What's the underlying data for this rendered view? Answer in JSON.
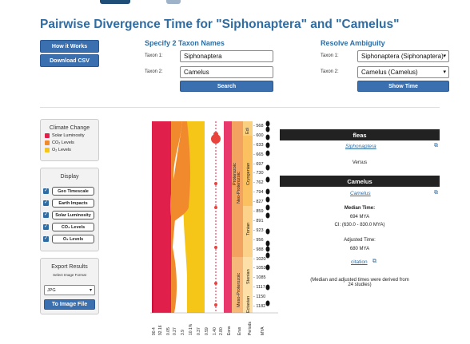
{
  "page": {
    "title": "Pairwise Divergence Time for \"Siphonaptera\" and \"Camelus\""
  },
  "actions": {
    "how_it_works": "How it Works",
    "download_csv": "Download CSV"
  },
  "specify": {
    "heading": "Specify 2 Taxon Names",
    "taxon1_label": "Taxon 1:",
    "taxon1_value": "Siphonaptera",
    "taxon2_label": "Taxon 2:",
    "taxon2_value": "Camelus",
    "search_label": "Search"
  },
  "resolve": {
    "heading": "Resolve Ambiguity",
    "taxon1_label": "Taxon 1:",
    "taxon1_value": "Siphonaptera (Siphonaptera)",
    "taxon2_label": "Taxon 2:",
    "taxon2_value": "Camelus (Camelus)",
    "show_time_label": "Show Time"
  },
  "climate": {
    "title": "Climate Change",
    "items": [
      {
        "label": "Solar Luminosity",
        "color": "#e0204a"
      },
      {
        "label": "CO₂ Levels",
        "color": "#f08a2c"
      },
      {
        "label": "O₂ Levels",
        "color": "#f5c518"
      }
    ]
  },
  "display": {
    "title": "Display",
    "items": [
      "Geo Timescale",
      "Earth Impacts",
      "Solar Luminosity",
      "CO₂ Levels",
      "O₂ Levels"
    ]
  },
  "export": {
    "title": "Export Results",
    "format_label": "Select Image Format",
    "format_value": "JPG",
    "button_label": "To Image File"
  },
  "timeline": {
    "bottom_labels": [
      "90.4",
      "92.16",
      "0.05",
      "0.27",
      "3.9",
      "10.1%",
      "0.37",
      "0.59",
      "1.40",
      "2.80",
      "Eons",
      "Eras",
      "Periods",
      "MYA"
    ],
    "eon_label": "Proterozoic",
    "era_labels": [
      "Neo-Proterozoic",
      "Meso-Proterozoic"
    ],
    "period_labels": [
      "Edi",
      "Cryogenian",
      "Tonian",
      "Stenian",
      "Ectasian"
    ],
    "mya_ticks": [
      "568",
      "600",
      "633",
      "665",
      "697",
      "730",
      "762",
      "794",
      "827",
      "859",
      "891",
      "923",
      "956",
      "988",
      "1020",
      "1053",
      "1085",
      "1117",
      "1150",
      "1182"
    ]
  },
  "results": {
    "taxon1_common": "fleas",
    "taxon1_link": "Siphonaptera",
    "versus": "Versus",
    "taxon2_common": "Camelus",
    "taxon2_link": "Camelus",
    "median_label": "Median Time:",
    "median_value": "694 MYA",
    "ci_value": "CI: (630.0 - 830.0 MYA)",
    "adjusted_label": "Adjusted Time:",
    "adjusted_value": "680 MYA",
    "citation_label": "citation",
    "note": "(Median and adjusted times were derived from 24 studies)"
  },
  "colors": {
    "accent": "#2e6da4",
    "button": "#3a6fb0",
    "solar": "#e0204a",
    "co2": "#f08a2c",
    "o2": "#f5c518"
  }
}
